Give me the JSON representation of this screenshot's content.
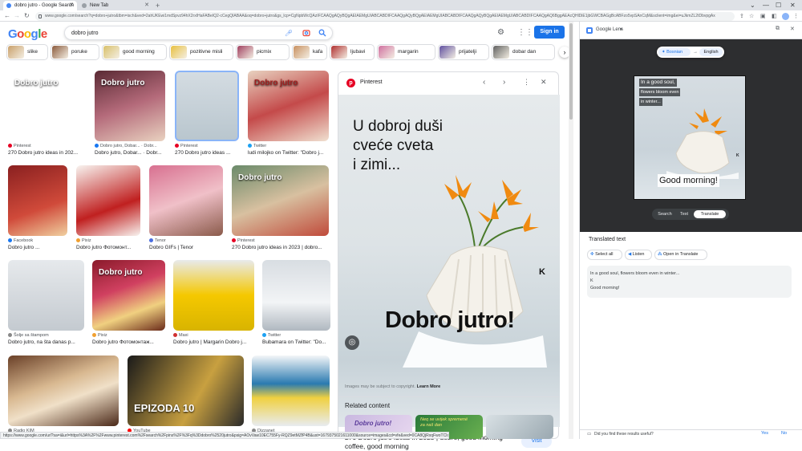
{
  "browser": {
    "tabs": [
      {
        "title": "dobro jutro - Google Search",
        "active": true
      },
      {
        "title": "New Tab",
        "active": false
      }
    ],
    "new_tab_glyph": "+",
    "window_controls": [
      "⌄",
      "—",
      "☐",
      "✕"
    ],
    "url": "www.google.com/search?q=dobro+jutro&tbm=isch&ved=2ahUKEwi1mdSpvz94hX2rxIHaFABeIQ2-cCegQIABAA&oq=dobro+jutro&gs_lcp=CgNpbWcQAzIFCAAQgAQyBQgAEIAEMgUIABCABDIFCAAQgAQyBQgAEIAEMgUIABCABDIFCAAQgAQyBQgAEIAEMgUIABCABDIFCAAQgAQ6BggAEAcQHlDiE1jbGWCBAGgBcABFzo5vpSAnCqM&sclient=img&ei=uJkmZL2tDbvpgAx",
    "nav": {
      "back": "←",
      "forward": "→",
      "reload": "↻"
    },
    "status_url": "https://www.google.com/url?sa=i&url=https%3A%2F%2Fwww.pinterest.com%2Fsearch%2Fpins%2F%3Fq%3Ddobro%2520jutro&psig=AOvVaw10EC755Fy-RQZ9etMZfP4B&ust=1679375021611000&source=images&cd=vfe&ved=0CA8QjRxqFwoTCIo9ba-rP0CFQAAAAAdAAAAABAE"
  },
  "google": {
    "logo": "Google",
    "logo_colors": [
      "#4285f4",
      "#ea4335",
      "#fbbc05",
      "#4285f4",
      "#34a853",
      "#ea4335"
    ],
    "query": "dobro jutro",
    "signin_label": "Sign in",
    "chips": [
      {
        "label": "slike",
        "color": "#c9a06a"
      },
      {
        "label": "poruke",
        "color": "#8a5a3c"
      },
      {
        "label": "good morning",
        "color": "#d8c06a"
      },
      {
        "label": "pozitivne misli",
        "color": "#e8c040"
      },
      {
        "label": "picmix",
        "color": "#a04060"
      },
      {
        "label": "kafa",
        "color": "#c89060"
      },
      {
        "label": "ljubavi",
        "color": "#b03030"
      },
      {
        "label": "margarin",
        "color": "#d070a0"
      },
      {
        "label": "prijatelji",
        "color": "#6050a0"
      },
      {
        "label": "dobar dan",
        "color": "#606060"
      }
    ],
    "chip_next": "›"
  },
  "results": [
    {
      "source": "Pinterest",
      "title": "270 Dobro jutro ideas in 202...",
      "overlay": "Dobro jutro",
      "srcColor": "#e60023"
    },
    {
      "source": "Dobro jutro, Dobar... · Dobr...",
      "title": "Dobro jutro, Dobar... · Dobr...",
      "overlay": "Dobro jutro",
      "srcColor": "#1877f2"
    },
    {
      "source": "Pinterest",
      "title": "270 Dobro jutro ideas ...",
      "overlay": "",
      "srcColor": "#e60023"
    },
    {
      "source": "Twitter",
      "title": "ludi milojko on Twitter: \"Dobro j...",
      "overlay": "Dobro jutro",
      "srcColor": "#1da1f2"
    },
    {
      "source": "Facebook",
      "title": "Dobro jutro ...",
      "overlay": "",
      "srcColor": "#1877f2"
    },
    {
      "source": "Pixiz",
      "title": "Dobro jutro Фотомонт...",
      "overlay": "",
      "srcColor": "#f0a030"
    },
    {
      "source": "Tenor",
      "title": "Dobro GIFs | Tenor",
      "overlay": "",
      "srcColor": "#4a6ee0"
    },
    {
      "source": "Pinterest",
      "title": "270 Dobro jutro ideas in 2023 | dobro...",
      "overlay": "Dobro jutro",
      "srcColor": "#e60023"
    },
    {
      "source": "Šolje sa štampom",
      "title": "Dobro jutro, na šta danas p...",
      "overlay": "",
      "srcColor": "#888888"
    },
    {
      "source": "Pixiz",
      "title": "Dobro jutro Фотомонтаж...",
      "overlay": "Dobro jutro",
      "srcColor": "#f0a030"
    },
    {
      "source": "Maxi",
      "title": "Dobro jutro | Margarin Dobro j...",
      "overlay": "",
      "srcColor": "#d03030"
    },
    {
      "source": "Twitter",
      "title": "Bubamara on Twitter: \"Do...",
      "overlay": "",
      "srcColor": "#1da1f2"
    },
    {
      "source": "Radio KIM",
      "title": "",
      "overlay": "",
      "srcColor": "#888888"
    },
    {
      "source": "YouTube",
      "title": "",
      "overlay": "EPIZODA 10",
      "srcColor": "#ff0000"
    },
    {
      "source": "Dizzanet",
      "title": "",
      "overlay": "",
      "srcColor": "#888888"
    }
  ],
  "preview": {
    "source": "Pinterest",
    "image_text_top": "U dobroj duši\ncveće cveta\ni zimi...",
    "image_text_bottom": "Dobro jutro!",
    "image_k": "K",
    "title": "270 Dobro jutro ideas in 2023 | dobro, good morning coffee, good morning",
    "visit_label": "Visit",
    "copyright": "Images may be subject to copyright.",
    "learn_more": "Learn More",
    "related": "Related content",
    "related_thumb_1": "Dobro jutro!",
    "related_thumb_2": "Neq se uvijek spremené\nza naš dan"
  },
  "lens": {
    "title": "Google Lens",
    "from_lang": "Bosnian",
    "to_lang": "English",
    "translated_lines": [
      "In a good soul,",
      "flowers bloom even",
      "in winter..."
    ],
    "translated_bottom": "Good morning!",
    "modes": [
      "Search",
      "Text",
      "Translate"
    ],
    "active_mode": "Translate",
    "translated_heading": "Translated text",
    "select_all": "Select all",
    "listen": "Listen",
    "open_translate": "Open in Translate",
    "output_lines": [
      "In a good soul, flowers bloom even in winter...",
      "K",
      "Good morning!"
    ],
    "feedback_q": "Did you find these results useful?",
    "yes": "Yes",
    "no": "No"
  }
}
